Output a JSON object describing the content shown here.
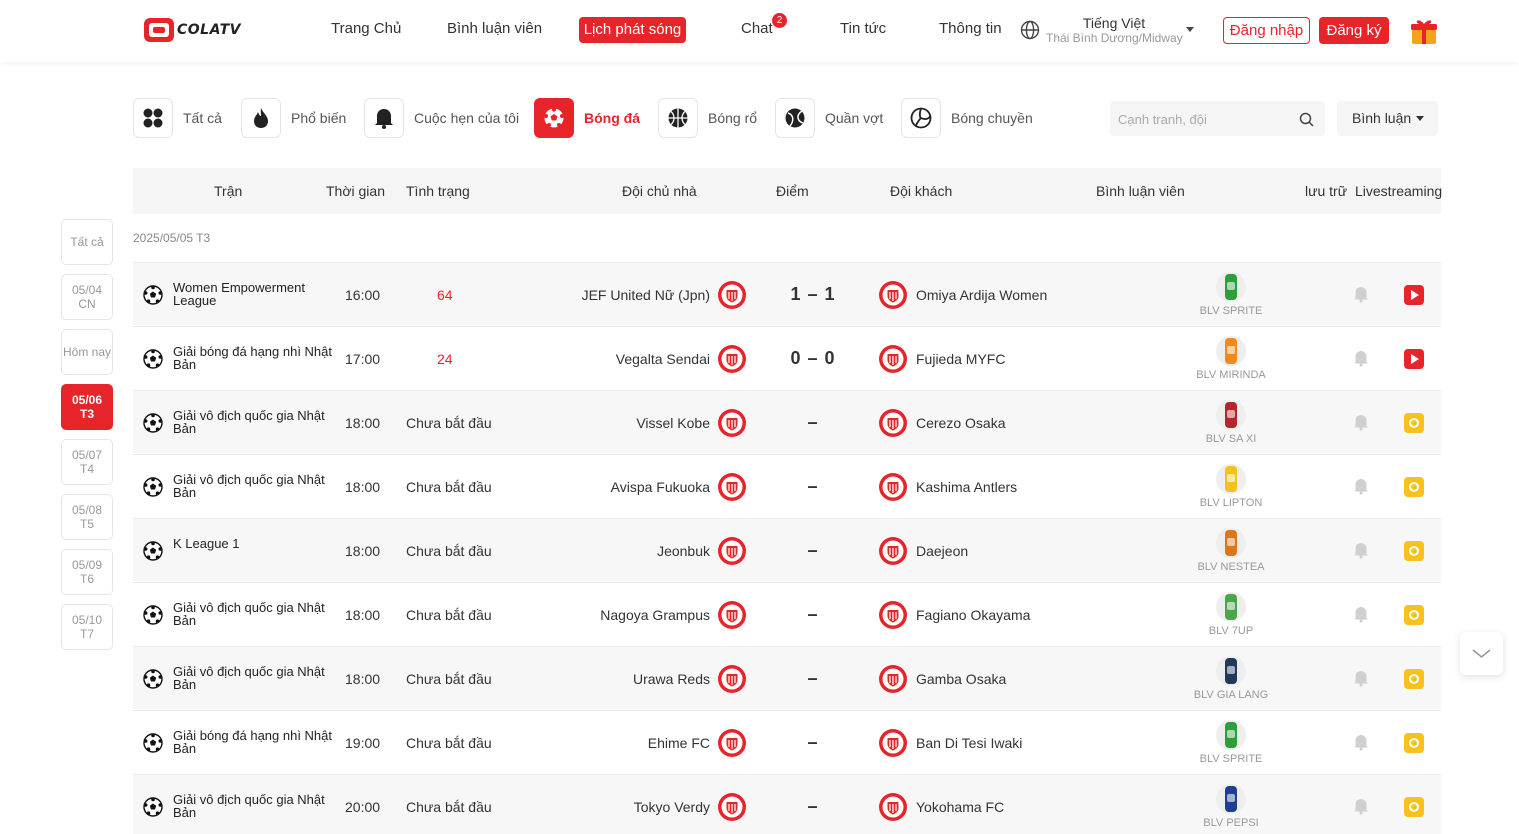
{
  "header": {
    "logo_text": "COLATV",
    "nav": [
      "Trang Chủ",
      "Bình luận viên",
      "Lịch phát sóng",
      "Chat",
      "Tin tức",
      "Thông tin"
    ],
    "chat_badge": "2",
    "language": "Tiếng Việt",
    "timezone": "Thái Bình Dương/Midway",
    "login": "Đăng nhập",
    "register": "Đăng ký"
  },
  "categories": [
    "Tất cả",
    "Phổ biến",
    "Cuộc hẹn của tôi",
    "Bóng đá",
    "Bóng rổ",
    "Quần vợt",
    "Bóng chuyền"
  ],
  "search": {
    "placeholder": "Cạnh tranh, đội"
  },
  "filter_select": "Bình luận",
  "dates": [
    {
      "line1": "Tất cả",
      "line2": ""
    },
    {
      "line1": "05/04",
      "line2": "CN"
    },
    {
      "line1": "Hôm nay",
      "line2": ""
    },
    {
      "line1": "05/06",
      "line2": "T3"
    },
    {
      "line1": "05/07",
      "line2": "T4"
    },
    {
      "line1": "05/08",
      "line2": "T5"
    },
    {
      "line1": "05/09",
      "line2": "T6"
    },
    {
      "line1": "05/10",
      "line2": "T7"
    }
  ],
  "table": {
    "headers": [
      "Trận",
      "Thời gian",
      "Tình trạng",
      "Đội chủ nhà",
      "Điểm",
      "Đội khách",
      "Bình luận viên",
      "lưu trữ",
      "Livestreaming"
    ],
    "date_label": "2025/05/05 T3",
    "rows": [
      {
        "league": "Women Empowerment League",
        "time": "16:00",
        "status": "64",
        "home": "JEF United Nữ (Jpn)",
        "score": "1 – 1",
        "away": "Omiya Ardija Women",
        "blv": "BLV SPRITE",
        "avatar_color": "#2f9e3a",
        "live": true
      },
      {
        "league": "Giải bóng đá hạng nhì Nhật Bản",
        "time": "17:00",
        "status": "24",
        "home": "Vegalta Sendai",
        "score": "0 – 0",
        "away": "Fujieda MYFC",
        "blv": "BLV MIRINDA",
        "avatar_color": "#f08a1c",
        "live": true
      },
      {
        "league": "Giải vô địch quốc gia Nhật Bản",
        "time": "18:00",
        "status": "Chưa bắt đầu",
        "home": "Vissel Kobe",
        "score": "–",
        "away": "Cerezo Osaka",
        "blv": "BLV SA XI",
        "avatar_color": "#b3262c",
        "live": false
      },
      {
        "league": "Giải vô địch quốc gia Nhật Bản",
        "time": "18:00",
        "status": "Chưa bắt đầu",
        "home": "Avispa Fukuoka",
        "score": "–",
        "away": "Kashima Antlers",
        "blv": "BLV LIPTON",
        "avatar_color": "#f4c21d",
        "live": false
      },
      {
        "league": "K League 1",
        "time": "18:00",
        "status": "Chưa bắt đầu",
        "home": "Jeonbuk",
        "score": "–",
        "away": "Daejeon",
        "blv": "BLV NESTEA",
        "avatar_color": "#d9771d",
        "live": false
      },
      {
        "league": "Giải vô địch quốc gia Nhật Bản",
        "time": "18:00",
        "status": "Chưa bắt đầu",
        "home": "Nagoya Grampus",
        "score": "–",
        "away": "Fagiano Okayama",
        "blv": "BLV 7UP",
        "avatar_color": "#4aa64a",
        "live": false
      },
      {
        "league": "Giải vô địch quốc gia Nhật Bản",
        "time": "18:00",
        "status": "Chưa bắt đầu",
        "home": "Urawa Reds",
        "score": "–",
        "away": "Gamba Osaka",
        "blv": "BLV GIA LANG",
        "avatar_color": "#1f3a5c",
        "live": false
      },
      {
        "league": "Giải bóng đá hạng nhì Nhật Bản",
        "time": "19:00",
        "status": "Chưa bắt đầu",
        "home": "Ehime FC",
        "score": "–",
        "away": "Ban Di Tesi Iwaki",
        "blv": "BLV SPRITE",
        "avatar_color": "#2f9e3a",
        "live": false
      },
      {
        "league": "Giải vô địch quốc gia Nhật Bản",
        "time": "20:00",
        "status": "Chưa bắt đầu",
        "home": "Tokyo Verdy",
        "score": "–",
        "away": "Yokohama FC",
        "blv": "BLV PEPSI",
        "avatar_color": "#1d3f8f",
        "live": false
      }
    ]
  },
  "colors": {
    "accent": "#e8242b",
    "remind": "#f6c21b"
  }
}
